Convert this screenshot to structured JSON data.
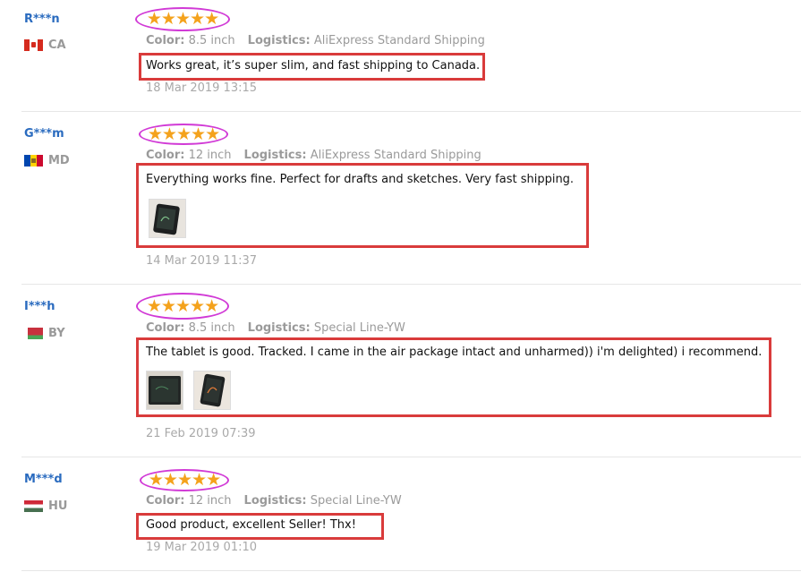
{
  "reviews": [
    {
      "user": "R***n",
      "country": "CA",
      "rating": 5,
      "color_label": "Color:",
      "color_value": "8.5 inch",
      "logistics_label": "Logistics:",
      "logistics_value": "AliExpress Standard Shipping",
      "text": "Works great, it’s super slim, and fast shipping to Canada.",
      "date": "18 Mar 2019 13:15",
      "photos": []
    },
    {
      "user": "G***m",
      "country": "MD",
      "rating": 5,
      "color_label": "Color:",
      "color_value": "12 inch",
      "logistics_label": "Logistics:",
      "logistics_value": "AliExpress Standard Shipping",
      "text": "Everything works fine. Perfect for drafts and sketches. Very fast shipping.",
      "date": "14 Mar 2019 11:37",
      "photos": [
        "photo-1"
      ]
    },
    {
      "user": "I***h",
      "country": "BY",
      "rating": 5,
      "color_label": "Color:",
      "color_value": "8.5 inch",
      "logistics_label": "Logistics:",
      "logistics_value": "Special Line-YW",
      "text": "The tablet is good. Tracked. I came in the air package intact and unharmed)) i'm delighted) i recommend.",
      "date": "21 Feb 2019 07:39",
      "photos": [
        "photo-1",
        "photo-2"
      ]
    },
    {
      "user": "M***d",
      "country": "HU",
      "rating": 5,
      "color_label": "Color:",
      "color_value": "12 inch",
      "logistics_label": "Logistics:",
      "logistics_value": "Special Line-YW",
      "text": "Good product, excellent Seller! Thx!",
      "date": "19 Mar 2019 01:10",
      "photos": []
    }
  ],
  "colors": {
    "username": "#2a6bbf",
    "star": "#f4a21c",
    "star_highlight": "#d13ad6",
    "text_highlight": "#d93b3b"
  }
}
